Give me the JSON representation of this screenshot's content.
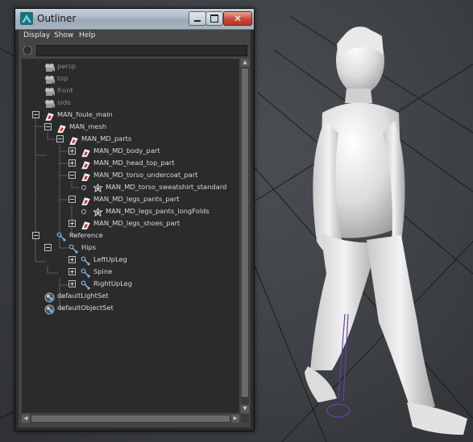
{
  "window": {
    "title": "Outliner",
    "close_glyph": "✕"
  },
  "menu": {
    "display": "Display",
    "show": "Show",
    "help": "Help"
  },
  "filter": {
    "value": ""
  },
  "tree": [
    {
      "label": "persp",
      "icon": "camera-icon"
    },
    {
      "label": "top",
      "icon": "camera-icon"
    },
    {
      "label": "front",
      "icon": "camera-icon"
    },
    {
      "label": "side",
      "icon": "camera-icon"
    },
    {
      "label": "MAN_foule_main",
      "icon": "transform-icon"
    },
    {
      "label": "MAN_mesh",
      "icon": "transform-icon"
    },
    {
      "label": "MAN_MD_parts",
      "icon": "transform-icon"
    },
    {
      "label": "MAN_MD_body_part",
      "icon": "transform-icon"
    },
    {
      "label": "MAN_MD_head_top_part",
      "icon": "transform-icon"
    },
    {
      "label": "MAN_MD_torso_undercoat_part",
      "icon": "transform-icon"
    },
    {
      "label": "MAN_MD_torso_sweatshirt_standard",
      "icon": "shape-icon"
    },
    {
      "label": "MAN_MD_legs_pants_part",
      "icon": "transform-icon"
    },
    {
      "label": "MAN_MD_legs_pants_longFolds",
      "icon": "shape-icon"
    },
    {
      "label": "MAN_MD_legs_shoes_part",
      "icon": "transform-icon"
    },
    {
      "label": "Reference",
      "icon": "joint-icon"
    },
    {
      "label": "Hips",
      "icon": "joint-icon"
    },
    {
      "label": "LeftUpLeg",
      "icon": "joint-icon"
    },
    {
      "label": "Spine",
      "icon": "joint-icon"
    },
    {
      "label": "RightUpLeg",
      "icon": "joint-icon"
    },
    {
      "label": "defaultLightSet",
      "icon": "set-icon"
    },
    {
      "label": "defaultObjectSet",
      "icon": "set-icon"
    }
  ],
  "colors": {
    "panel": "#2b2b2b",
    "frame": "#444444",
    "text": "#dadada",
    "muted_text": "#8a8a8a"
  }
}
